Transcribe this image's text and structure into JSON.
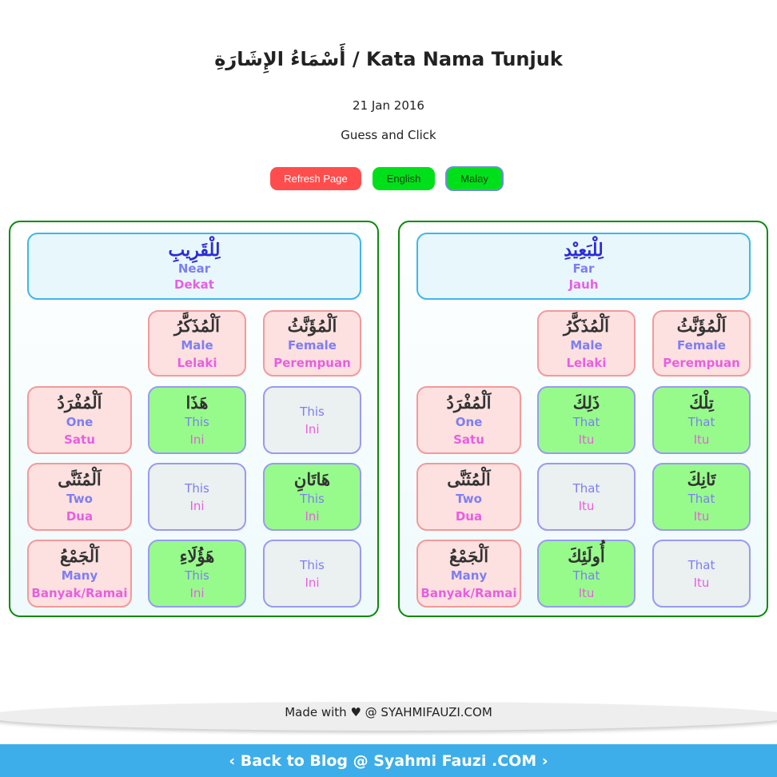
{
  "page": {
    "title": "أَسْمَاءُ الإِشَارَةِ / Kata Nama Tunjuk",
    "date": "21 Jan 2016",
    "subtitle": "Guess and Click"
  },
  "buttons": {
    "refresh": "Refresh Page",
    "english": "English",
    "malay": "Malay"
  },
  "panels": [
    {
      "header": {
        "ar": "لِلْقَرِيبِ",
        "en": "Near",
        "ms": "Dekat"
      },
      "genders": [
        {
          "ar": "اَلْمُذَكَّرُ",
          "en": "Male",
          "ms": "Lelaki"
        },
        {
          "ar": "اَلْمُؤَنَّثُ",
          "en": "Female",
          "ms": "Perempuan"
        }
      ],
      "rows": [
        {
          "label": {
            "ar": "اَلْمُفْرَدُ",
            "en": "One",
            "ms": "Satu"
          },
          "cells": [
            {
              "ar": "هَذَا",
              "en": "This",
              "ms": "Ini"
            },
            {
              "ar": "",
              "en": "This",
              "ms": "Ini"
            }
          ]
        },
        {
          "label": {
            "ar": "اَلْمُثَنَّى",
            "en": "Two",
            "ms": "Dua"
          },
          "cells": [
            {
              "ar": "",
              "en": "This",
              "ms": "Ini"
            },
            {
              "ar": "هَاتَانِ",
              "en": "This",
              "ms": "Ini"
            }
          ]
        },
        {
          "label": {
            "ar": "اَلْجَمْعُ",
            "en": "Many",
            "ms": "Banyak/Ramai"
          },
          "cells": [
            {
              "ar": "هَؤُلَاءِ",
              "en": "This",
              "ms": "Ini"
            },
            {
              "ar": "",
              "en": "This",
              "ms": "Ini"
            }
          ]
        }
      ]
    },
    {
      "header": {
        "ar": "لِلْبَعِيْدِ",
        "en": "Far",
        "ms": "Jauh"
      },
      "genders": [
        {
          "ar": "اَلْمُذَكَّرُ",
          "en": "Male",
          "ms": "Lelaki"
        },
        {
          "ar": "اَلْمُؤَنَّثُ",
          "en": "Female",
          "ms": "Perempuan"
        }
      ],
      "rows": [
        {
          "label": {
            "ar": "اَلْمُفْرَدُ",
            "en": "One",
            "ms": "Satu"
          },
          "cells": [
            {
              "ar": "ذَلِكَ",
              "en": "That",
              "ms": "Itu"
            },
            {
              "ar": "تِلْكَ",
              "en": "That",
              "ms": "Itu"
            }
          ]
        },
        {
          "label": {
            "ar": "اَلْمُثَنَّى",
            "en": "Two",
            "ms": "Dua"
          },
          "cells": [
            {
              "ar": "",
              "en": "That",
              "ms": "Itu"
            },
            {
              "ar": "تَانِكَ",
              "en": "That",
              "ms": "Itu"
            }
          ]
        },
        {
          "label": {
            "ar": "اَلْجَمْعُ",
            "en": "Many",
            "ms": "Banyak/Ramai"
          },
          "cells": [
            {
              "ar": "أُولَئِكَ",
              "en": "That",
              "ms": "Itu"
            },
            {
              "ar": "",
              "en": "That",
              "ms": "Itu"
            }
          ]
        }
      ]
    }
  ],
  "footer": {
    "made_with": "Made with ♥ @ SYAHMIFAUZI.COM",
    "back_link": "‹ Back to Blog @ Syahmi Fauzi .COM ›"
  },
  "colors": {
    "revealed_cell": "#97fb8c",
    "hidden_cell": "#ebf0f0",
    "label_cell": "#fde0e0",
    "header_cell": "#e8f7fc",
    "refresh_button": "#ff4d4d",
    "language_button": "#00e01a",
    "back_bar": "#3daee9"
  }
}
